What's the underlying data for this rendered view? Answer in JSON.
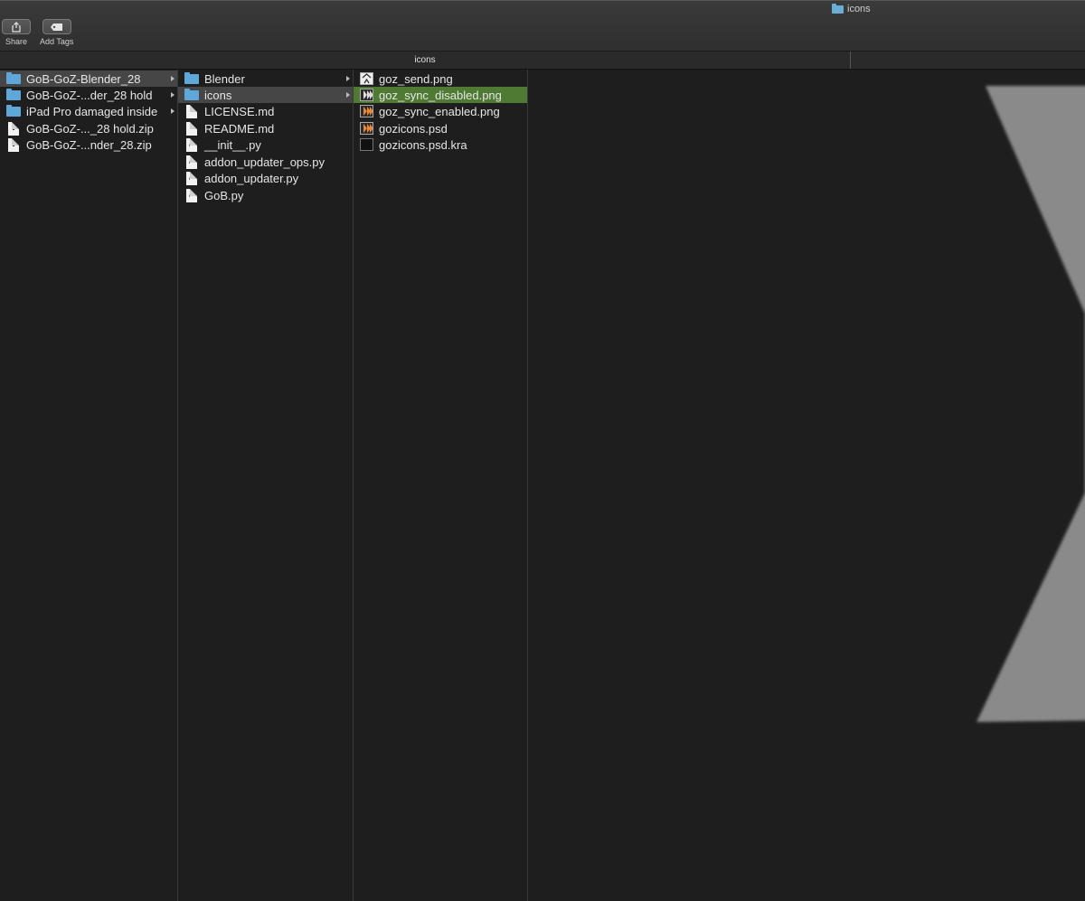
{
  "window": {
    "title": "icons"
  },
  "toolbar": {
    "share_label": "Share",
    "add_tags_label": "Add Tags"
  },
  "pathbar": {
    "current": "icons"
  },
  "columns": [
    {
      "items": [
        {
          "label": "GoB-GoZ-Blender_28",
          "icon": "folder-icon",
          "has_children": true,
          "selected": "gray"
        },
        {
          "label": "GoB-GoZ-...der_28 hold",
          "icon": "folder-icon",
          "has_children": true,
          "selected": ""
        },
        {
          "label": "iPad Pro damaged inside",
          "icon": "folder-icon",
          "has_children": true,
          "selected": ""
        },
        {
          "label": "GoB-GoZ-..._28 hold.zip",
          "icon": "zip-file-icon",
          "has_children": false,
          "selected": ""
        },
        {
          "label": "GoB-GoZ-...nder_28.zip",
          "icon": "zip-file-icon",
          "has_children": false,
          "selected": ""
        }
      ]
    },
    {
      "items": [
        {
          "label": "Blender",
          "icon": "folder-icon",
          "has_children": true,
          "selected": ""
        },
        {
          "label": "icons",
          "icon": "folder-icon",
          "has_children": true,
          "selected": "gray"
        },
        {
          "label": "LICENSE.md",
          "icon": "document-icon",
          "has_children": false,
          "selected": ""
        },
        {
          "label": "README.md",
          "icon": "document-icon",
          "has_children": false,
          "selected": ""
        },
        {
          "label": "__init__.py",
          "icon": "python-file-icon",
          "has_children": false,
          "selected": ""
        },
        {
          "label": "addon_updater_ops.py",
          "icon": "python-file-icon",
          "has_children": false,
          "selected": ""
        },
        {
          "label": "addon_updater.py",
          "icon": "python-file-icon",
          "has_children": false,
          "selected": ""
        },
        {
          "label": "GoB.py",
          "icon": "python-file-icon",
          "has_children": false,
          "selected": ""
        }
      ]
    },
    {
      "items": [
        {
          "label": "goz_send.png",
          "icon": "goz-send-image-icon",
          "has_children": false,
          "selected": ""
        },
        {
          "label": "goz_sync_disabled.png",
          "icon": "goz-sync-disabled-image-icon",
          "has_children": false,
          "selected": "green"
        },
        {
          "label": "goz_sync_enabled.png",
          "icon": "goz-sync-enabled-image-icon",
          "has_children": false,
          "selected": ""
        },
        {
          "label": "gozicons.psd",
          "icon": "psd-file-icon",
          "has_children": false,
          "selected": ""
        },
        {
          "label": "gozicons.psd.kra",
          "icon": "kra-file-icon",
          "has_children": false,
          "selected": ""
        }
      ]
    }
  ],
  "colors": {
    "folder": "#5fa7d8",
    "selection_active": "#4e7a34",
    "selection_inactive": "#464646",
    "preview_shape": "#8a8a8a",
    "orange_chevrons": "#e8893a"
  }
}
